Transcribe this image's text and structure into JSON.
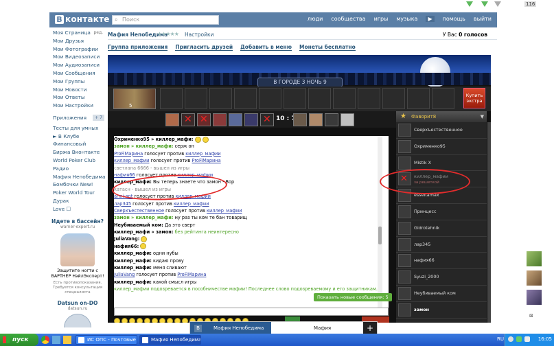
{
  "vk": {
    "logo_text": "контакте",
    "logo_letter": "В",
    "search_placeholder": "Поиск",
    "nav": [
      "люди",
      "сообщества",
      "игры",
      "музыка",
      "помощь",
      "выйти"
    ],
    "nav_arrow": "▶"
  },
  "left_menu": [
    {
      "label": "Моя Страница",
      "extra": "ред."
    },
    {
      "label": "Мои Друзья"
    },
    {
      "label": "Мои Фотографии"
    },
    {
      "label": "Мои Видеозаписи"
    },
    {
      "label": "Мои Аудиозаписи"
    },
    {
      "label": "Мои Сообщения"
    },
    {
      "label": "Мои Группы"
    },
    {
      "label": "Мои Новости"
    },
    {
      "label": "Мои Ответы"
    },
    {
      "label": "Мои Настройки"
    }
  ],
  "apps_menu": [
    {
      "label": "Приложения",
      "badge": "+ 7"
    },
    {
      "label": "Тесты для умных"
    },
    {
      "label": "► В Клубе"
    },
    {
      "label": "Финансовый"
    },
    {
      "label": "Биржа Вконтакте"
    },
    {
      "label": "World Poker Club"
    },
    {
      "label": "Радио"
    },
    {
      "label": "Мафия Непобедима"
    },
    {
      "label": "Бомбочки New!"
    },
    {
      "label": "Poker World Tour"
    },
    {
      "label": "Дурак"
    },
    {
      "label": "Love ☐"
    }
  ],
  "ad": {
    "title": "Идете в бассейн?",
    "site": "warner-expert.ru",
    "text": "Защитите ногти с ВАРТНЕР НэйлЭксперт!",
    "small": "Есть противопоказания. Требуется консультация специалиста"
  },
  "ad2": {
    "title": "Datsun on-DO",
    "site": "datsun.ru"
  },
  "app": {
    "title": "Мафия Непобедима",
    "stars": "★★★★★",
    "settings": "Настройки",
    "votes_prefix": "У Вас",
    "votes_value": "0 голосов",
    "links": [
      "Группа приложения",
      "Пригласить друзей",
      "Добавить в меню",
      "Монеты бесплатно"
    ]
  },
  "game": {
    "night_label": "В ГОРОДЕ 3 НОЧЬ 9",
    "my_number": "5",
    "buy_label": "Купить экстра",
    "score": "10 : 7",
    "new_messages": "Показать новые сообщения: 5",
    "favorites_title": "Фаворит",
    "favorites_count": "8"
  },
  "chat": [
    {
      "parts": [
        {
          "c": "u",
          "t": "Охрименко95 » киллер_мафи:"
        },
        {
          "c": "emo",
          "t": ""
        },
        {
          "c": "emo",
          "t": ""
        }
      ]
    },
    {
      "parts": [
        {
          "c": "g",
          "t": "замон » киллер_мафи:"
        },
        {
          "c": "",
          "t": " серж он"
        }
      ]
    },
    {
      "parts": [
        {
          "c": "lk",
          "t": "ProFiМарина"
        },
        {
          "c": "",
          "t": " голосует против "
        },
        {
          "c": "lk",
          "t": "киллер_мафии"
        }
      ]
    },
    {
      "parts": [
        {
          "c": "lk",
          "t": "киллер_мафии"
        },
        {
          "c": "",
          "t": " голосует против "
        },
        {
          "c": "lk",
          "t": "ProFiМарина"
        }
      ]
    },
    {
      "parts": [
        {
          "c": "gr",
          "t": "светлана 6666 - вышел из игры"
        }
      ]
    },
    {
      "parts": [
        {
          "c": "lk",
          "t": "нафия66"
        },
        {
          "c": "",
          "t": " голосует против "
        },
        {
          "c": "lk",
          "t": "киллер_мафии"
        }
      ]
    },
    {
      "parts": [
        {
          "c": "u",
          "t": "киллер_мафи:"
        },
        {
          "c": "",
          "t": " Вы теперь знаете что замон - Вор"
        }
      ]
    },
    {
      "parts": [
        {
          "c": "gr",
          "t": "катасн - вышел из игры"
        }
      ]
    },
    {
      "parts": [
        {
          "c": "lk",
          "t": "anni-ant"
        },
        {
          "c": "",
          "t": " голосует против "
        },
        {
          "c": "lk",
          "t": "киллер_мафии"
        }
      ]
    },
    {
      "parts": [
        {
          "c": "lk",
          "t": "лар345"
        },
        {
          "c": "",
          "t": " голосует против "
        },
        {
          "c": "lk",
          "t": "киллер_мафии"
        }
      ]
    },
    {
      "parts": [
        {
          "c": "lk",
          "t": "Сверхъестественное"
        },
        {
          "c": "",
          "t": " голосует против "
        },
        {
          "c": "lk",
          "t": "киллер_мафии"
        }
      ]
    },
    {
      "parts": [
        {
          "c": "g",
          "t": "замон » киллер_мафи:"
        },
        {
          "c": "",
          "t": " ну раз ты ком те бан товарищ"
        }
      ]
    },
    {
      "parts": [
        {
          "c": "u",
          "t": "Неубиваемый ком:"
        },
        {
          "c": "",
          "t": " Да это сверт"
        }
      ]
    },
    {
      "parts": [
        {
          "c": "u",
          "t": "киллер_мафи » замон:"
        },
        {
          "c": "gt",
          "t": " без рейтинга неинтересно"
        }
      ]
    },
    {
      "parts": [
        {
          "c": "u",
          "t": "JuliaVang:"
        },
        {
          "c": "emo",
          "t": ""
        }
      ]
    },
    {
      "parts": [
        {
          "c": "u",
          "t": "нафия66:"
        },
        {
          "c": "emo",
          "t": ""
        }
      ]
    },
    {
      "parts": [
        {
          "c": "u",
          "t": "киллер_мафи:"
        },
        {
          "c": "",
          "t": " одни нубы"
        }
      ]
    },
    {
      "parts": [
        {
          "c": "u",
          "t": "киллер_мафи:"
        },
        {
          "c": "",
          "t": " кидаю прову"
        }
      ]
    },
    {
      "parts": [
        {
          "c": "u",
          "t": "киллер_мафи:"
        },
        {
          "c": "",
          "t": " меня сливают"
        }
      ]
    },
    {
      "parts": [
        {
          "c": "lk",
          "t": "JuliaVang"
        },
        {
          "c": "",
          "t": " голосует против "
        },
        {
          "c": "lk",
          "t": "ProFiМарина"
        }
      ]
    },
    {
      "parts": [
        {
          "c": "u",
          "t": "киллер_мафи:"
        },
        {
          "c": "",
          "t": " какой смысл игры"
        }
      ]
    },
    {
      "parts": [
        {
          "c": "gt",
          "t": "киллер_мафии подозревается в пособничестве мафии! Последнее слово подозреваемому и его защитникам."
        }
      ]
    }
  ],
  "favorites": [
    {
      "name": "Сверхъестественное"
    },
    {
      "name": "Охрименко95"
    },
    {
      "name": "Mistik X"
    },
    {
      "name": "киллер_мафии",
      "sub": "за решеткой",
      "dead": true
    },
    {
      "name": "esseltamax"
    },
    {
      "name": "Принцесс"
    },
    {
      "name": "Gidrotehnik"
    },
    {
      "name": "лар345"
    },
    {
      "name": "нафия66"
    },
    {
      "name": "Syuzi_2000"
    },
    {
      "name": "Неубиваемый ком"
    },
    {
      "name": "замон",
      "bold": true
    }
  ],
  "players": [
    {
      "dead": false,
      "color": "#b06a4a"
    },
    {
      "dead": true,
      "color": "#3a2a2a"
    },
    {
      "dead": true,
      "color": "#6a2a2a"
    },
    {
      "dead": false,
      "color": "#8a3a3a"
    },
    {
      "dead": false,
      "color": "#5a6a9a"
    },
    {
      "dead": false,
      "color": "#3a3a6a"
    },
    {
      "dead": true,
      "color": "#2a2a2a"
    },
    {
      "dead": false,
      "color": "#6a5a4a"
    },
    {
      "dead": false,
      "color": "#b08a6a"
    },
    {
      "dead": false,
      "color": "#3a3a3a"
    },
    {
      "dead": false,
      "color": "#c0c0c0"
    }
  ],
  "taskbar": {
    "start": "пуск",
    "tasks": [
      "ИС ОПС - Почтовые ...",
      "Мафия Непобедима ..."
    ],
    "lang": "RU",
    "clock": "16:05"
  },
  "tabstrip": {
    "tab1": "Мафия Непобедима",
    "tab2": "Мафия",
    "plus": "+"
  },
  "desk_badge": "116",
  "colors": {
    "vk_blue": "#5b7fa6",
    "link": "#2b587a",
    "annotation_red": "#e22c2c",
    "chat_green": "#4ea224"
  }
}
